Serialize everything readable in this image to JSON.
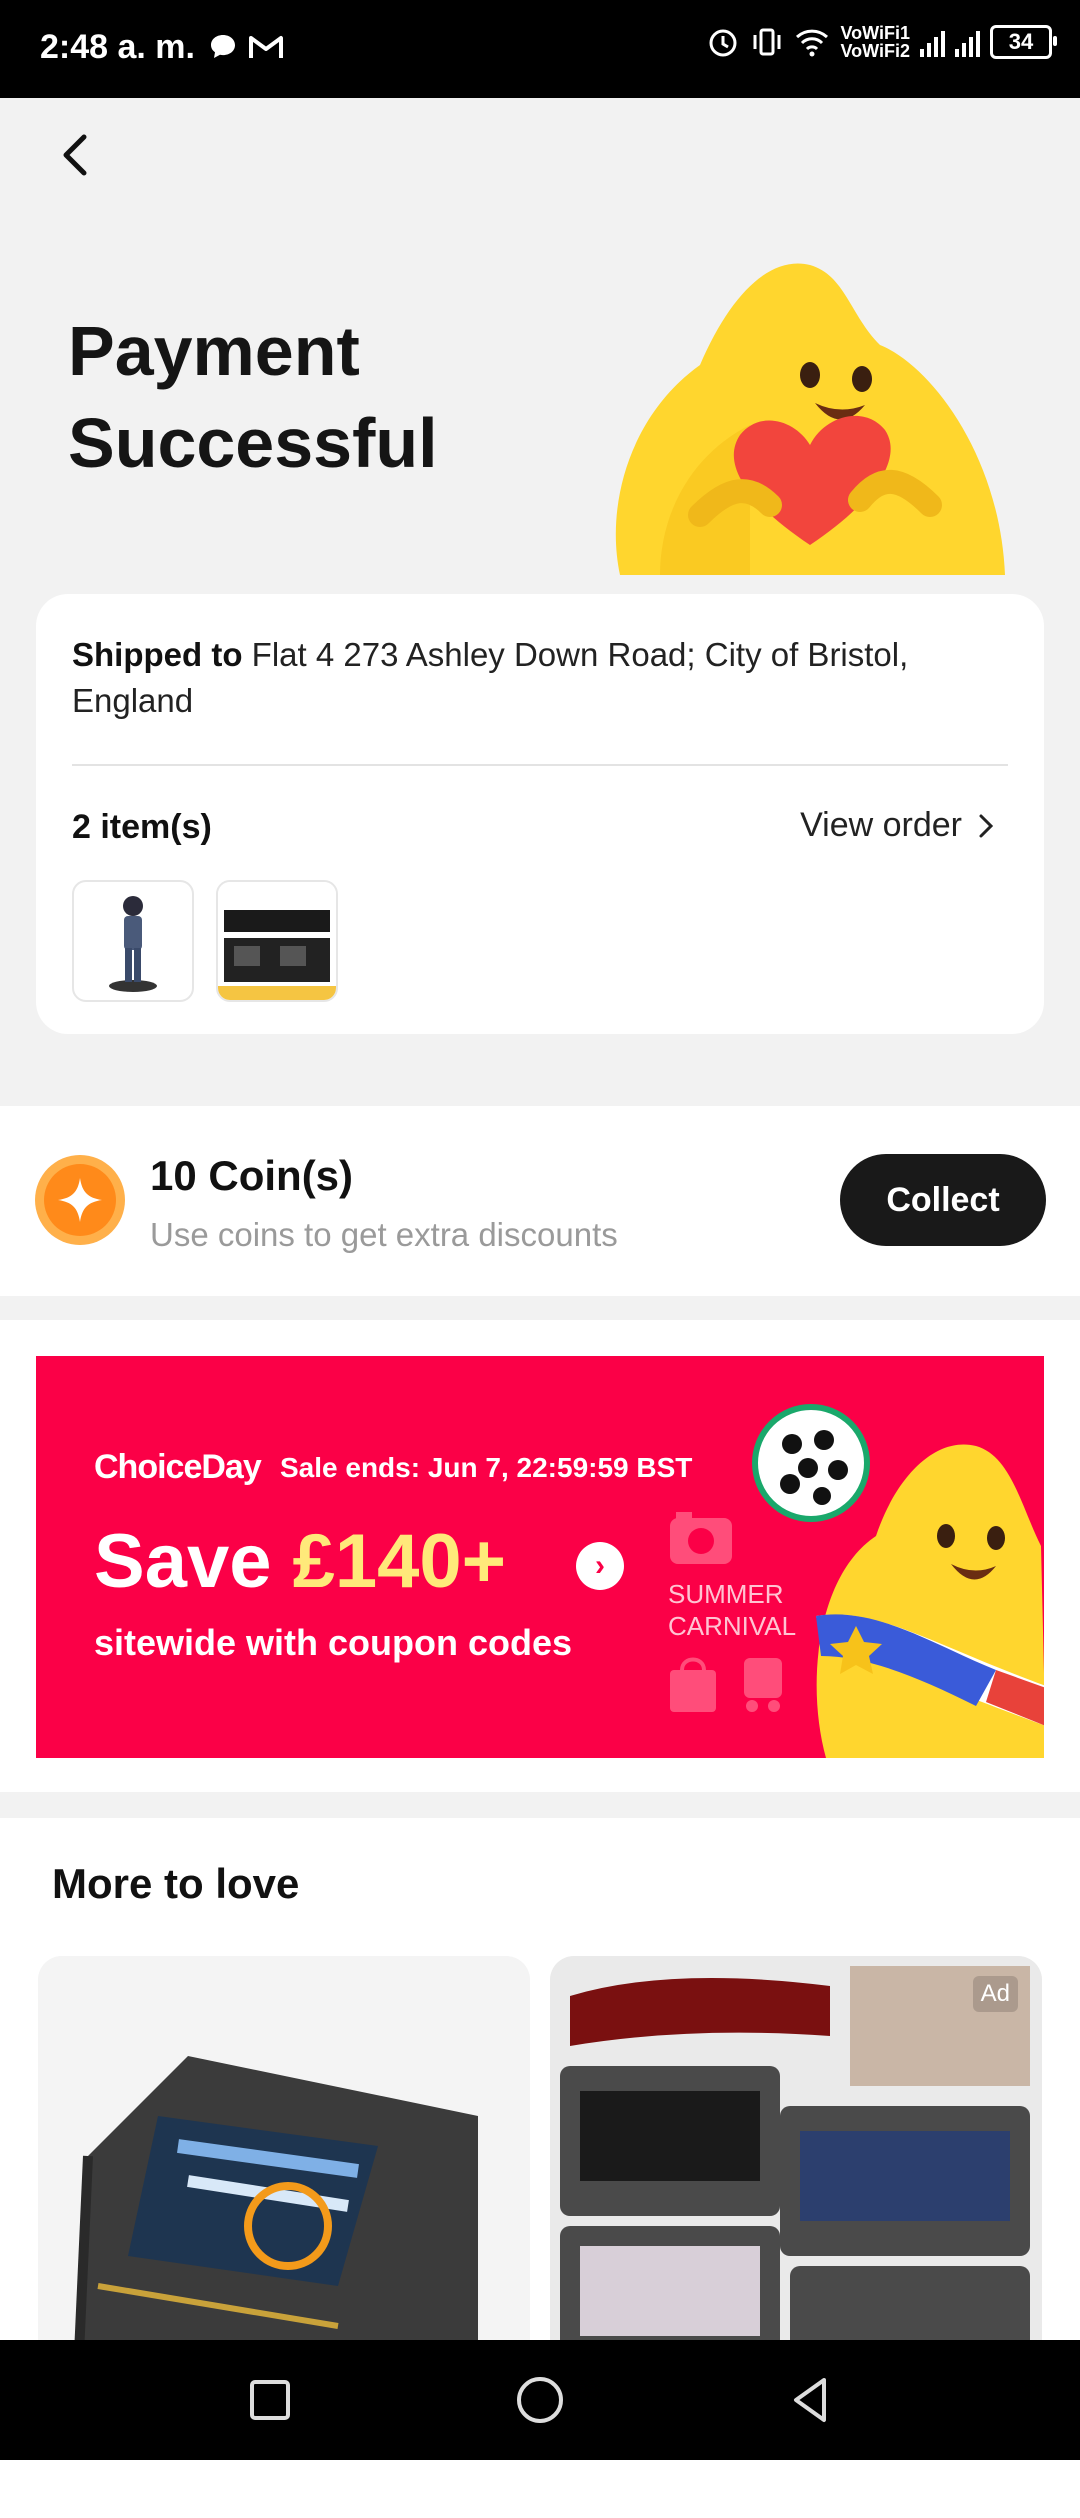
{
  "status_bar": {
    "time": "2:48 a. m.",
    "wifi_line1": "VoWiFi1",
    "wifi_line2": "VoWiFi2",
    "battery": "34"
  },
  "header": {
    "title_line1": "Payment",
    "title_line2": "Successful"
  },
  "shipping": {
    "label": "Shipped to",
    "address": "Flat 4 273 Ashley Down Road; City of Bristol, England",
    "items_count": "2 item(s)",
    "view_order": "View order"
  },
  "coins": {
    "title": "10 Coin(s)",
    "subtitle": "Use coins to get extra discounts",
    "collect": "Collect"
  },
  "banner": {
    "brand": "ChoiceDay",
    "sale_ends": "Sale ends: Jun 7, 22:59:59 BST",
    "save_prefix": "Save ",
    "save_amount": "£140+",
    "sitewide": "sitewide with coupon codes",
    "summer_line1": "SUMMER",
    "summer_line2": "CARNIVAL"
  },
  "more_to_love": {
    "title": "More to love",
    "ad_label": "Ad"
  },
  "colors": {
    "banner_bg": "#fb0047",
    "collect_bg": "#191919",
    "coin_orange": "#ff8a1a"
  }
}
